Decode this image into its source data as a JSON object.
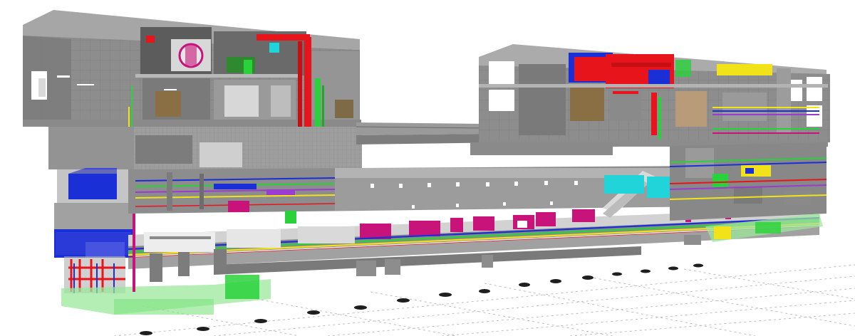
{
  "view": {
    "kind": "bim-3d-section-view",
    "background": "#ffffff"
  },
  "palette": {
    "concrete": "#8f8f8f",
    "concrete_dark": "#6f6f6f",
    "concrete_light": "#b4b4b4",
    "slab": "#a3a3a3",
    "floor_tile": "#cfcfcf",
    "mep_red": "#e8141b",
    "mep_green": "#29d13a",
    "mep_blue": "#1b2fd6",
    "mep_magenta": "#c8147a",
    "mep_cyan": "#21d4da",
    "mep_yellow": "#f2e21a",
    "mep_purple": "#9b3bd1",
    "mep_brown": "#9a7a45",
    "transparent_green": "#9be89b",
    "pile_cap": "#1e1e1e",
    "grid_line": "#9a9a9a"
  }
}
